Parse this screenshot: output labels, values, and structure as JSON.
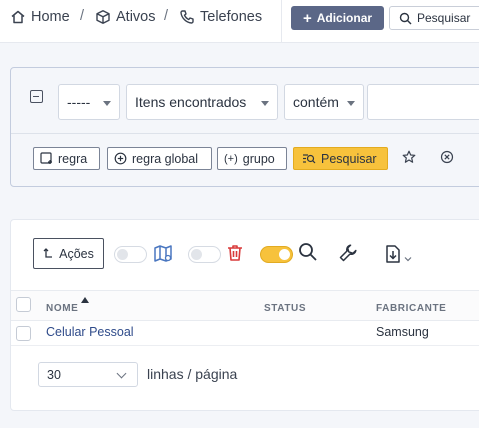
{
  "breadcrumb": {
    "home": "Home",
    "ativos": "Ativos",
    "telefones": "Telefones",
    "separator": "/"
  },
  "toolbar": {
    "add_label": "Adicionar",
    "search_label": "Pesquisar"
  },
  "filter": {
    "field_select": "-----",
    "scope_select": "Itens encontrados",
    "operator_select": "contém",
    "value_input": "",
    "add_rule": "regra",
    "add_global_rule": "regra global",
    "add_group": "grupo",
    "search_button": "Pesquisar"
  },
  "table_toolbar": {
    "actions_label": "Ações"
  },
  "table": {
    "columns": [
      "NOME",
      "STATUS",
      "FABRICANTE"
    ],
    "sort_column": "NOME",
    "sort_direction": "asc",
    "rows": [
      {
        "nome": "Celular Pessoal",
        "status": "",
        "fabricante": "Samsung"
      }
    ]
  },
  "pagination": {
    "per_page": "30",
    "per_page_label": "linhas / página"
  },
  "colors": {
    "primary_button": "#5b6787",
    "accent_yellow": "#f7c23c",
    "link": "#2f4b8a",
    "danger": "#d93a3a"
  }
}
